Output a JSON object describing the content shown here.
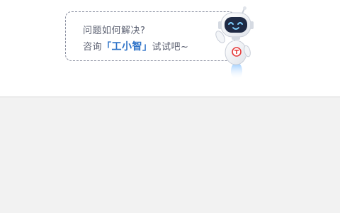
{
  "assistant_prompt": {
    "question": "问题如何解决?",
    "cta_prefix": "咨询",
    "bracket_open": "「",
    "assistant_name": "工小智",
    "bracket_close": "」",
    "cta_suffix": "试试吧~"
  },
  "colors": {
    "accent": "#2f73c8",
    "text": "#5a5f70",
    "border": "#8a8fa0",
    "robot_badge": "#e63b3b",
    "bottom_bg": "#f2f2f2"
  },
  "icons": {
    "mascot": "robot-mascot-icon",
    "badge": "robot-badge-icon"
  }
}
